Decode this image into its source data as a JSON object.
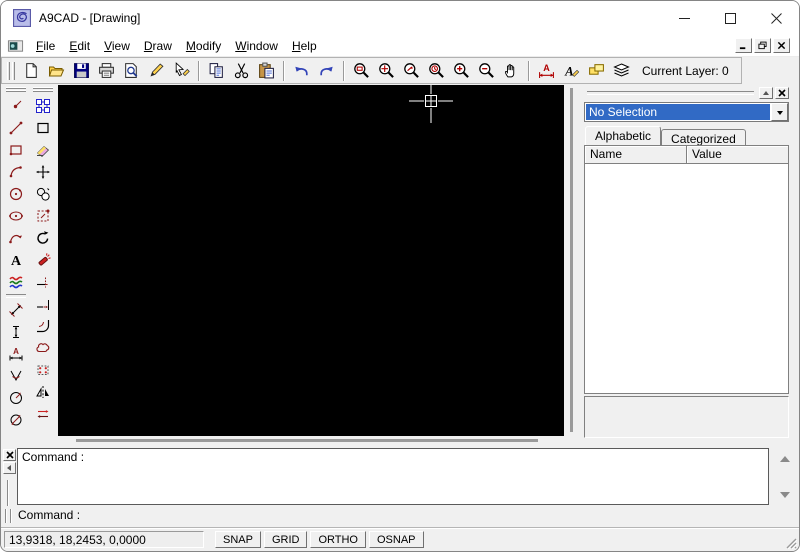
{
  "window": {
    "title": "A9CAD - [Drawing]"
  },
  "menu": {
    "items": [
      {
        "label": "File",
        "underline": 0
      },
      {
        "label": "Edit",
        "underline": 0
      },
      {
        "label": "View",
        "underline": 0
      },
      {
        "label": "Draw",
        "underline": 0
      },
      {
        "label": "Modify",
        "underline": 0
      },
      {
        "label": "Window",
        "underline": 0
      },
      {
        "label": "Help",
        "underline": 0
      }
    ]
  },
  "toolbar": {
    "buttons": [
      {
        "name": "new",
        "icon": "new-icon"
      },
      {
        "name": "open",
        "icon": "open-icon"
      },
      {
        "name": "save",
        "icon": "save-icon"
      },
      {
        "name": "print",
        "icon": "print-icon"
      },
      {
        "name": "print-preview",
        "icon": "print-preview-icon"
      },
      {
        "name": "edit-pencil",
        "icon": "pencil-icon"
      },
      {
        "name": "pick",
        "icon": "pick-icon"
      },
      {
        "sep": true
      },
      {
        "name": "copy",
        "icon": "copy-icon"
      },
      {
        "name": "cut",
        "icon": "cut-icon"
      },
      {
        "name": "paste",
        "icon": "paste-icon"
      },
      {
        "sep": true
      },
      {
        "name": "undo",
        "icon": "undo-icon"
      },
      {
        "name": "redo",
        "icon": "redo-icon"
      },
      {
        "sep": true
      },
      {
        "name": "zoom-window",
        "icon": "zoom-window-icon"
      },
      {
        "name": "zoom-extents",
        "icon": "zoom-extents-icon"
      },
      {
        "name": "zoom-dynamic",
        "icon": "zoom-dynamic-icon"
      },
      {
        "name": "zoom-previous",
        "icon": "zoom-previous-icon"
      },
      {
        "name": "zoom-in",
        "icon": "zoom-in-icon"
      },
      {
        "name": "zoom-out",
        "icon": "zoom-out-icon"
      },
      {
        "name": "pan",
        "icon": "pan-icon"
      },
      {
        "sep": true
      },
      {
        "name": "dimension-style",
        "icon": "dimension-icon"
      },
      {
        "name": "text-style",
        "icon": "text-style-icon"
      },
      {
        "name": "properties",
        "icon": "properties-icon"
      },
      {
        "name": "layers",
        "icon": "layers-icon"
      }
    ],
    "current_layer_label": "Current Layer: 0"
  },
  "palette": {
    "draw_tools": [
      {
        "name": "point",
        "icon": "point-icon"
      },
      {
        "name": "line",
        "icon": "line-icon"
      },
      {
        "name": "rectangle",
        "icon": "rectangle-icon"
      },
      {
        "name": "arc",
        "icon": "arc-icon"
      },
      {
        "name": "circle",
        "icon": "circle-icon"
      },
      {
        "name": "ellipse",
        "icon": "ellipse-icon"
      },
      {
        "name": "polyline",
        "icon": "polyline-icon"
      },
      {
        "name": "text",
        "icon": "text-icon"
      },
      {
        "name": "hatch",
        "icon": "hatch-icon"
      },
      {
        "sep": true
      },
      {
        "name": "dim-aligned",
        "icon": "dim-aligned-icon"
      },
      {
        "name": "dim-vertical",
        "icon": "dim-vertical-icon"
      },
      {
        "name": "dim-horizontal",
        "icon": "dim-horizontal-icon"
      },
      {
        "name": "dim-angular",
        "icon": "dim-angular-icon"
      },
      {
        "name": "dim-radius",
        "icon": "dim-radius-icon"
      },
      {
        "name": "dim-diameter",
        "icon": "dim-diameter-icon"
      }
    ],
    "modify_tools": [
      {
        "name": "select",
        "icon": "select-icon"
      },
      {
        "name": "select-window",
        "icon": "select-window-icon"
      },
      {
        "name": "erase",
        "icon": "erase-icon"
      },
      {
        "name": "move",
        "icon": "move-icon"
      },
      {
        "name": "copy-object",
        "icon": "copy-object-icon"
      },
      {
        "name": "scale",
        "icon": "scale-icon"
      },
      {
        "name": "rotate",
        "icon": "rotate-icon"
      },
      {
        "name": "explode",
        "icon": "explode-icon"
      },
      {
        "name": "trim",
        "icon": "trim-icon"
      },
      {
        "name": "extend",
        "icon": "extend-icon"
      },
      {
        "name": "fillet",
        "icon": "fillet-icon"
      },
      {
        "name": "revision-cloud",
        "icon": "cloud-icon"
      },
      {
        "name": "array",
        "icon": "array-icon"
      },
      {
        "name": "mirror",
        "icon": "mirror-icon"
      },
      {
        "name": "offset",
        "icon": "offset-icon"
      }
    ]
  },
  "properties_panel": {
    "selector_value": "No Selection",
    "tabs": [
      "Alphabetic",
      "Categorized"
    ],
    "active_tab": "Alphabetic",
    "grid_columns": [
      "Name",
      "Value"
    ],
    "rows": []
  },
  "command_area": {
    "history_lines": [
      "Command :"
    ],
    "prompt_label": "Command :"
  },
  "status_bar": {
    "coordinates": "13,9318, 18,2453, 0,0000",
    "toggles": [
      "SNAP",
      "GRID",
      "ORTHO",
      "OSNAP"
    ]
  }
}
